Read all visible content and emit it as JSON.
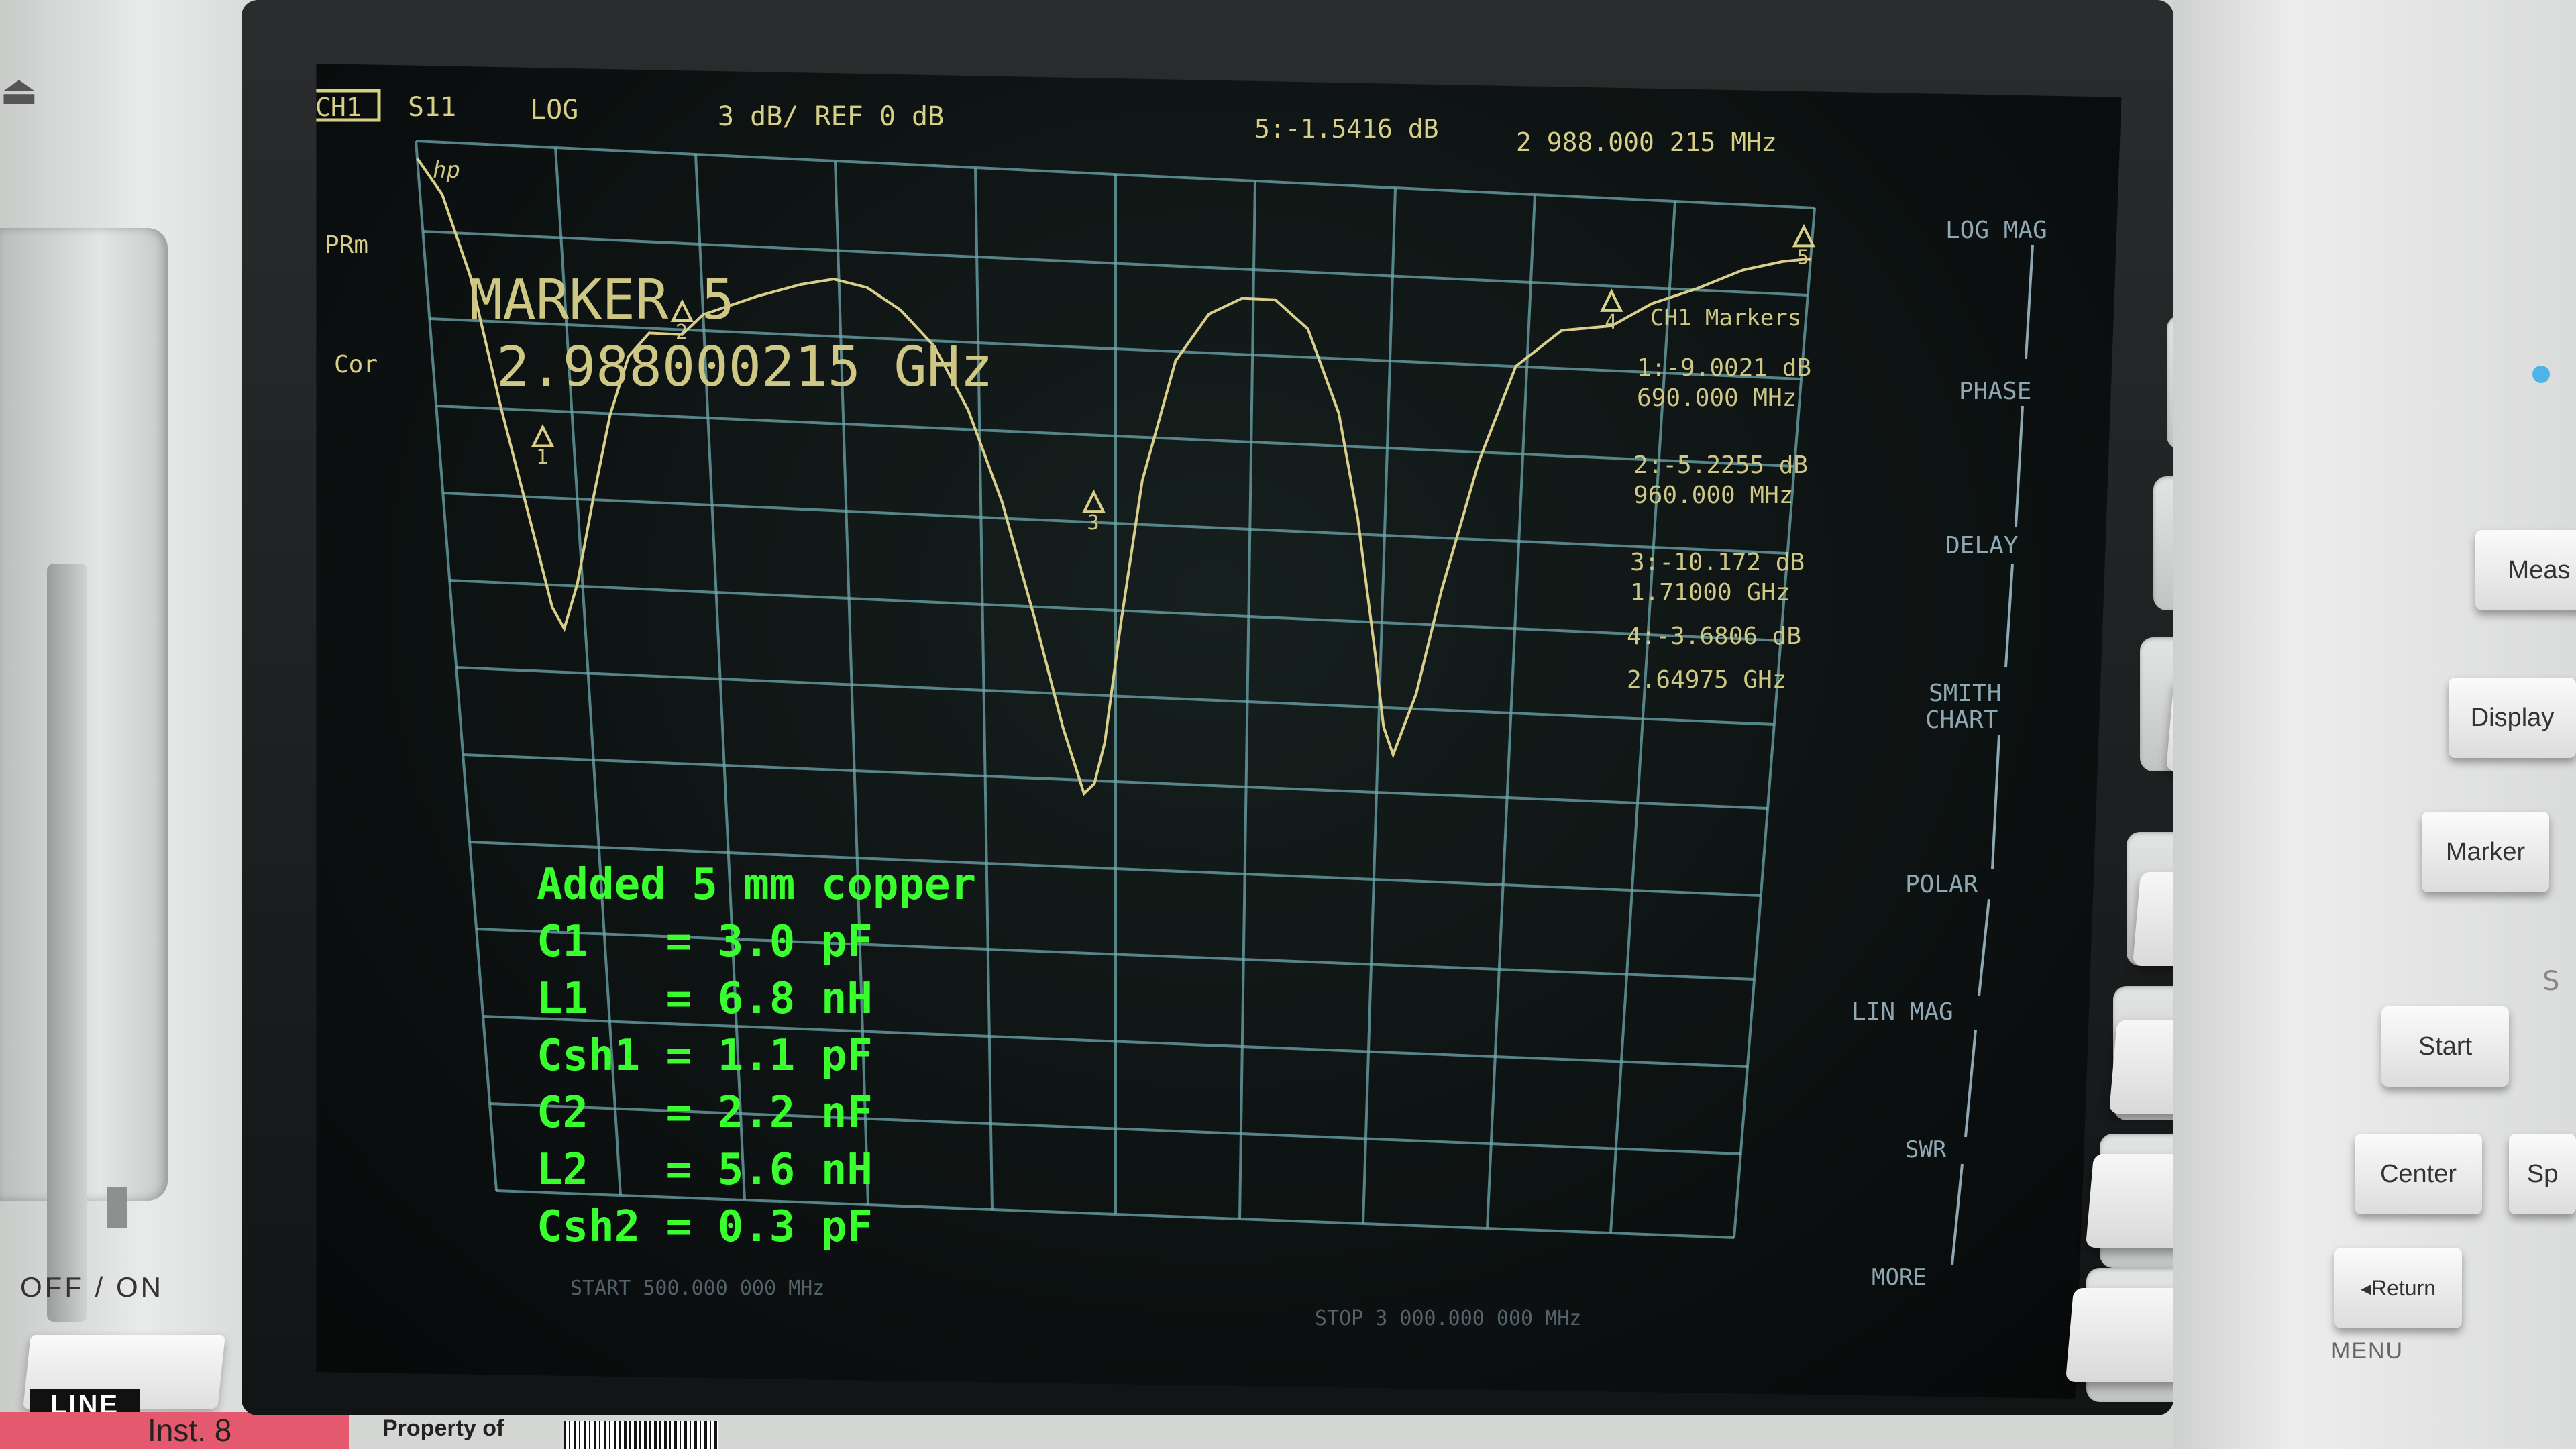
{
  "header": {
    "channel": "CH1",
    "param": "S11",
    "format": "LOG",
    "scale": "3 dB/ REF 0 dB",
    "marker_readout": "5:-1.5416 dB",
    "marker_freq": "2 988.000 215 MHz"
  },
  "status": {
    "prm": "PRm",
    "cor": "Cor"
  },
  "marker_title": {
    "line1": "MARKER 5",
    "line2": "2.988000215 GHz"
  },
  "marker_table": {
    "title": "CH1 Markers",
    "m1_val": "1:-9.0021 dB",
    "m1_freq": "690.000 MHz",
    "m2_val": "2:-5.2255 dB",
    "m2_freq": "960.000 MHz",
    "m3_val": "3:-10.172 dB",
    "m3_freq": "1.71000 GHz",
    "m4_val": "4:-3.6806 dB",
    "m4_freq": "2.64975 GHz"
  },
  "start_label": "START 500.000 000 MHz",
  "stop_label": "STOP 3 000.000 000 MHz",
  "softkeys": {
    "log_mag": "LOG MAG",
    "phase": "PHASE",
    "delay": "DELAY",
    "smith1": "SMITH",
    "smith2": "CHART",
    "polar": "POLAR",
    "lin_mag": "LIN MAG",
    "swr": "SWR",
    "more": "MORE"
  },
  "annotation": [
    "Added 5 mm copper",
    "C1   = 3.0 pF",
    "L1   = 6.8 nH",
    "Csh1 = 1.1 pF",
    "C2   = 2.2 nF",
    "L2   = 5.6 nH",
    "Csh2 = 0.3 pF"
  ],
  "hardkeys": {
    "meas": "Meas",
    "display": "Display",
    "marker": "Marker",
    "start": "Start",
    "center": "Center",
    "sp": "Sp",
    "return": "Return",
    "menu": "MENU"
  },
  "front_panel": {
    "power": "OFF / ON",
    "line": "LINE",
    "asset_tag": "Inst. 8",
    "property": "Property of"
  },
  "chart_data": {
    "type": "line",
    "title": "",
    "xlabel": "",
    "ylabel": "",
    "x_unit": "GHz",
    "y_unit": "dB",
    "xlim": [
      0.5,
      3.0
    ],
    "ylim": [
      -30,
      0
    ],
    "grid": true,
    "series": [
      {
        "name": "S11",
        "x": [
          0.5,
          0.54,
          0.58,
          0.62,
          0.66,
          0.69,
          0.71,
          0.74,
          0.78,
          0.82,
          0.86,
          0.9,
          0.94,
          0.96,
          1.0,
          1.05,
          1.1,
          1.18,
          1.24,
          1.3,
          1.36,
          1.42,
          1.48,
          1.54,
          1.6,
          1.65,
          1.69,
          1.71,
          1.73,
          1.76,
          1.8,
          1.86,
          1.92,
          1.98,
          2.04,
          2.1,
          2.16,
          2.2,
          2.24,
          2.26,
          2.28,
          2.32,
          2.36,
          2.42,
          2.48,
          2.56,
          2.65,
          2.72,
          2.8,
          2.88,
          2.95,
          2.99,
          3.0
        ],
        "y": [
          -0.5,
          -1.5,
          -3.8,
          -7.6,
          -10.8,
          -13.2,
          -13.8,
          -12.5,
          -10.0,
          -7.6,
          -5.9,
          -5.2,
          -5.2,
          -5.2,
          -4.6,
          -4.3,
          -4.0,
          -3.6,
          -3.4,
          -3.6,
          -4.2,
          -5.2,
          -7.0,
          -9.6,
          -13.0,
          -16.0,
          -17.9,
          -17.6,
          -16.4,
          -13.0,
          -8.8,
          -5.3,
          -3.9,
          -3.4,
          -3.4,
          -4.2,
          -6.6,
          -9.6,
          -13.5,
          -15.6,
          -16.4,
          -14.6,
          -11.6,
          -7.8,
          -5.0,
          -3.9,
          -3.7,
          -3.0,
          -2.5,
          -1.9,
          -1.6,
          -1.5,
          -1.5
        ]
      }
    ],
    "markers": [
      {
        "label": "1",
        "x": 0.69,
        "y": -9.0021
      },
      {
        "label": "2",
        "x": 0.96,
        "y": -5.2255
      },
      {
        "label": "3",
        "x": 1.71,
        "y": -10.172
      },
      {
        "label": "4",
        "x": 2.64975,
        "y": -3.6806
      },
      {
        "label": "5",
        "x": 2.988000215,
        "y": -1.5416
      }
    ]
  }
}
